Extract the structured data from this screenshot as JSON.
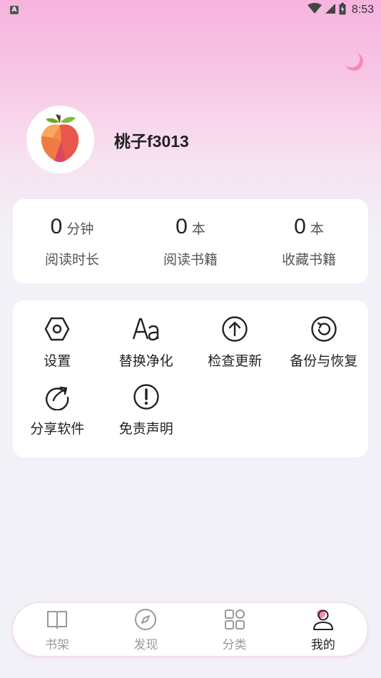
{
  "status_bar": {
    "app_indicator": "A",
    "time": "8:53"
  },
  "profile": {
    "username": "桃子f3013"
  },
  "stats": [
    {
      "value": "0",
      "unit": "分钟",
      "label": "阅读时长"
    },
    {
      "value": "0",
      "unit": "本",
      "label": "阅读书籍"
    },
    {
      "value": "0",
      "unit": "本",
      "label": "收藏书籍"
    }
  ],
  "menu": [
    {
      "label": "设置",
      "icon": "settings-hexagon-icon"
    },
    {
      "label": "替换净化",
      "icon": "font-aa-icon"
    },
    {
      "label": "检查更新",
      "icon": "arrow-up-circle-icon"
    },
    {
      "label": "备份与恢复",
      "icon": "restore-circle-icon"
    },
    {
      "label": "分享软件",
      "icon": "share-rotate-icon"
    },
    {
      "label": "免责声明",
      "icon": "exclamation-circle-icon"
    }
  ],
  "bottom_nav": [
    {
      "label": "书架",
      "icon": "book-icon",
      "active": false
    },
    {
      "label": "发现",
      "icon": "compass-icon",
      "active": false
    },
    {
      "label": "分类",
      "icon": "grid-icon",
      "active": false
    },
    {
      "label": "我的",
      "icon": "user-icon",
      "active": true
    }
  ],
  "colors": {
    "accent_pink": "#f48bb8",
    "header_gradient_top": "#f6b3de",
    "background": "#f2f1f7"
  }
}
